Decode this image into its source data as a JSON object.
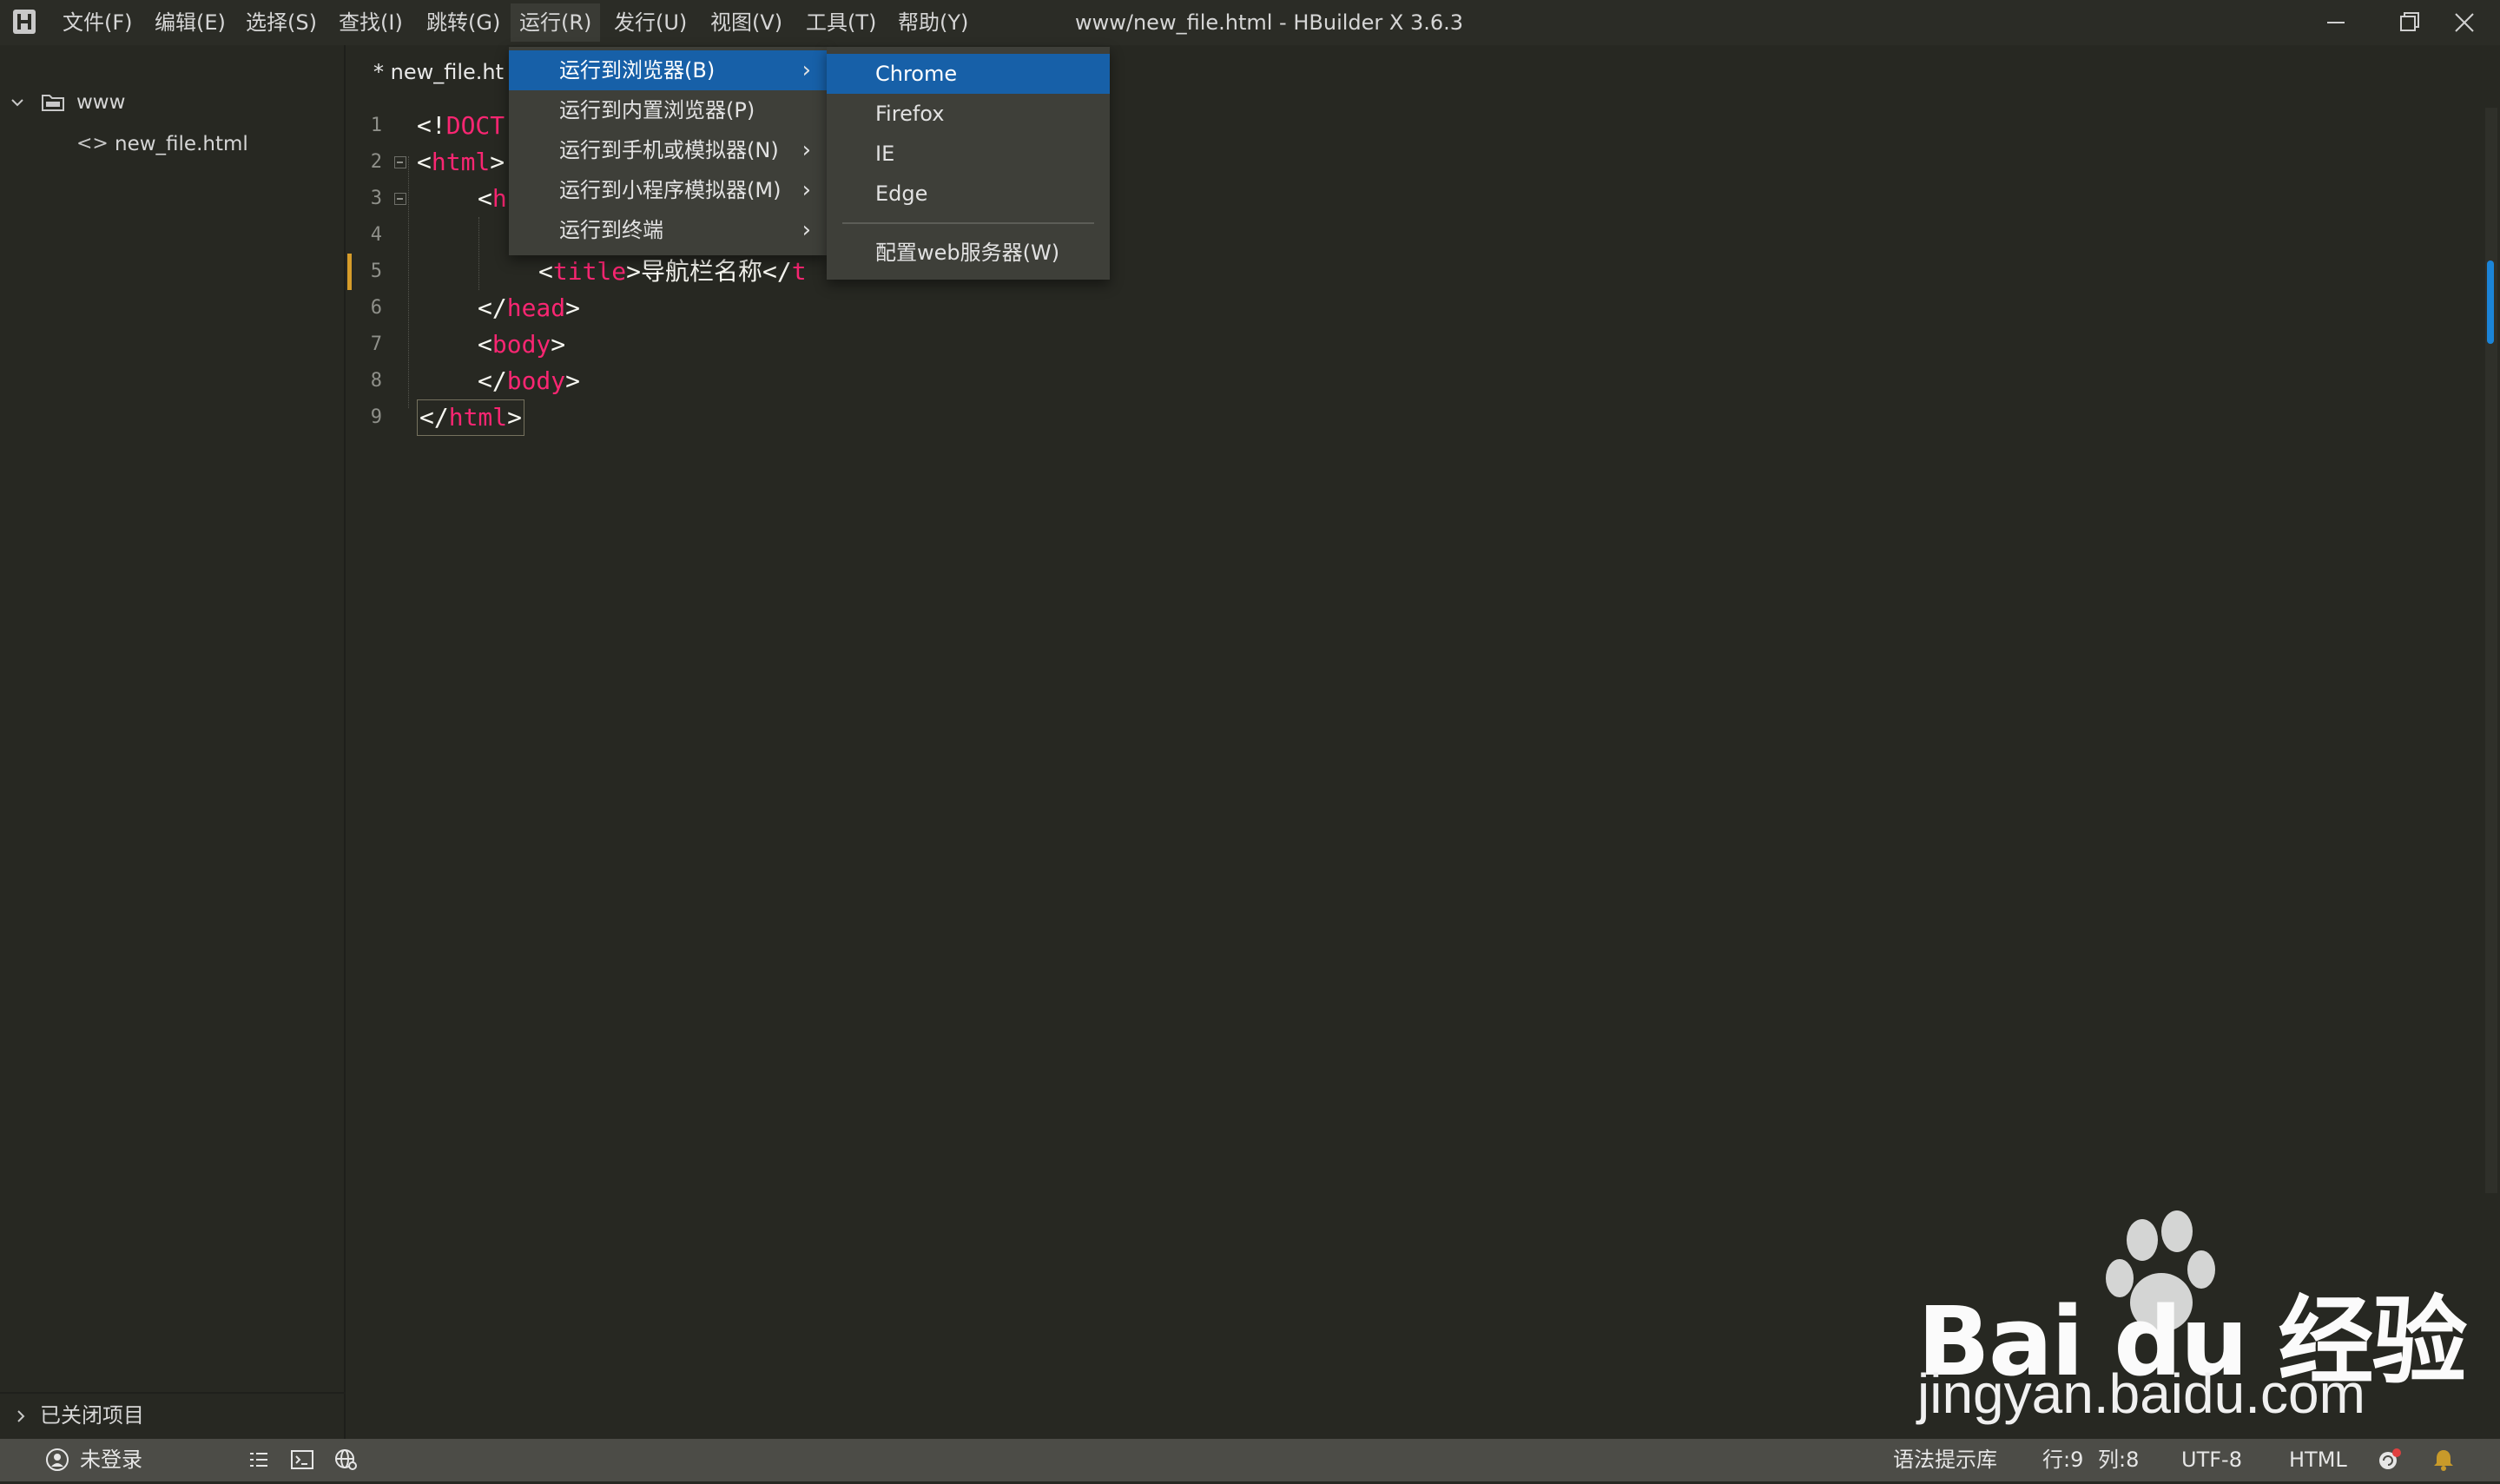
{
  "menubar": {
    "items": [
      "文件(F)",
      "编辑(E)",
      "选择(S)",
      "查找(I)",
      "跳转(G)",
      "运行(R)",
      "发行(U)",
      "视图(V)",
      "工具(T)",
      "帮助(Y)"
    ],
    "active": "运行(R)"
  },
  "window": {
    "title": "www/new_file.html - HBuilder X 3.6.3"
  },
  "sidebar": {
    "project": "www",
    "file": "new_file.html",
    "closed_projects": "已关闭项目"
  },
  "editor": {
    "tab": "* new_file.ht",
    "line_numbers": [
      "1",
      "2",
      "3",
      "4",
      "5",
      "6",
      "7",
      "8",
      "9"
    ],
    "lines": {
      "l1_open": "<!",
      "l1_doctype": "DOCT",
      "l2_tag": "html",
      "l3_tag": "h",
      "l5_tag": "title",
      "l5_text": "导航栏名称",
      "l5_close": "</",
      "l5_tag_end": "t",
      "l6_tag": "head",
      "l7_tag": "body",
      "l8_tag": "body",
      "l9_tag": "html"
    }
  },
  "run_menu": {
    "items": [
      {
        "label": "运行到浏览器(B)",
        "has_submenu": true
      },
      {
        "label": "运行到内置浏览器(P)",
        "has_submenu": false
      },
      {
        "label": "运行到手机或模拟器(N)",
        "has_submenu": true
      },
      {
        "label": "运行到小程序模拟器(M)",
        "has_submenu": true
      },
      {
        "label": "运行到终端",
        "has_submenu": true
      }
    ],
    "highlighted": "运行到浏览器(B)"
  },
  "browser_submenu": {
    "items": [
      "Chrome",
      "Firefox",
      "IE",
      "Edge"
    ],
    "config": "配置web服务器(W)",
    "highlighted": "Chrome"
  },
  "statusbar": {
    "login": "未登录",
    "syntax_lib": "语法提示库",
    "row": "行:9",
    "col": "列:8",
    "encoding": "UTF-8",
    "language": "HTML"
  },
  "watermark": {
    "brand": "Bai du 经验",
    "url": "jingyan.baidu.com"
  },
  "colors": {
    "accent": "#1760a8",
    "tag": "#f92672",
    "modified": "#d69c2a",
    "background": "#272822"
  }
}
